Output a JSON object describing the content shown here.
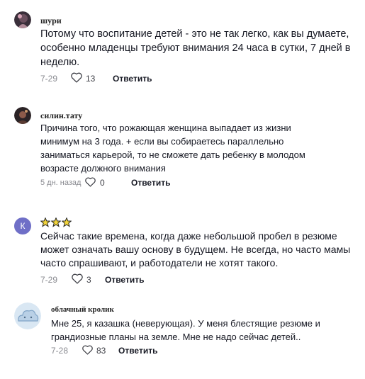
{
  "comments": [
    {
      "author": "шури",
      "text_lines": [
        "Потому что воспитание детей - это не так легко, как вы думаете,",
        "особенно младенцы требуют внимания 24 часа в сутки, 7 дней в",
        "неделю."
      ],
      "date": "7-29",
      "likes": "13",
      "reply_label": "Ответить"
    },
    {
      "author": "силин.тату",
      "text_lines": [
        "Причина того, что рожающая женщина выпадает из жизни",
        "минимум на 3 года. + если вы собираетесь параллельно",
        "заниматься карьерой, то не сможете дать ребенку в молодом",
        "возрасте должного внимания"
      ],
      "date": "5 дн. назад",
      "likes": "0",
      "reply_label": "Ответить"
    },
    {
      "avatar_letter": "К",
      "author_emoji": "🌟🌟🌟",
      "text_lines": [
        "Сейчас такие времена, когда даже небольшой пробел в резюме",
        "может означать вашу основу в будущем. Не всегда, но часто мамы",
        "часто спрашивают, и работодатели не хотят такого."
      ],
      "date": "7-29",
      "likes": "3",
      "reply_label": "Ответить"
    },
    {
      "author": "облачный кролик",
      "text_lines": [
        "Мне 25, я казашка (неверующая). У меня блестящие резюме и",
        "грандиозные планы на земле. Мне не надо сейчас детей.."
      ],
      "date": "7-28",
      "likes": "83",
      "reply_label": "Ответить"
    }
  ],
  "colors": {
    "avatar_k": "#6f6fc7",
    "star": "#f2d43a",
    "date": "#8a8b91"
  },
  "icons": [
    "heart-outline-icon",
    "star-icon"
  ]
}
